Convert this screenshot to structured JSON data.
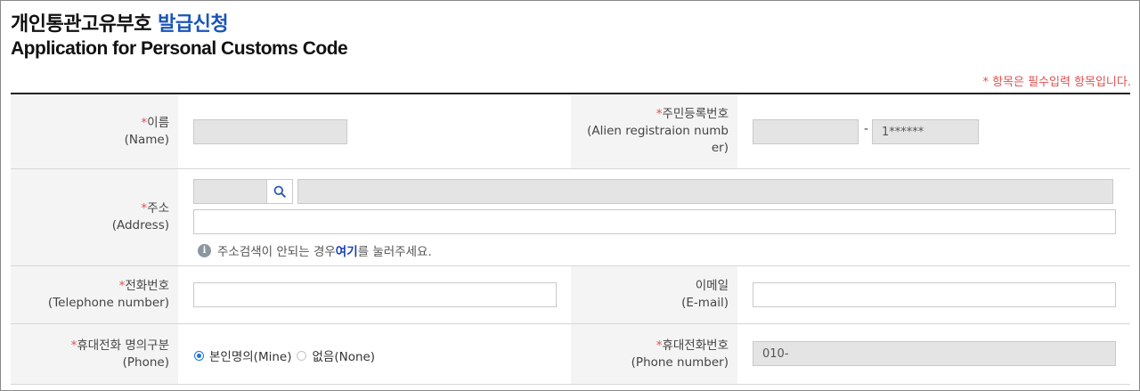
{
  "header": {
    "title_ko_main": "개인통관고유부호",
    "title_ko_accent": "발급신청",
    "title_en": "Application for Personal Customs Code",
    "required_note": "* 항목은 필수입력 항목입니다."
  },
  "rows": {
    "name": {
      "star": "*",
      "label_ko": "이름",
      "label_en": "(Name)",
      "value": ""
    },
    "rrn": {
      "star": "*",
      "label_ko": "주민등록번호",
      "label_en_1": "(Alien registraion numb",
      "label_en_2": "er)",
      "front_value": "",
      "dash": "-",
      "back_value": "1******"
    },
    "address": {
      "star": "*",
      "label_ko": "주소",
      "label_en": "(Address)",
      "zipcode": "",
      "base_address": "",
      "detail_address": "",
      "hint_before": "주소검색이 안되는 경우 ",
      "hint_link": "여기",
      "hint_after": "를 눌러주세요.",
      "search_icon": "search-icon",
      "info_icon": "info-icon"
    },
    "telephone": {
      "star": "*",
      "label_ko": "전화번호",
      "label_en": "(Telephone number)",
      "value": ""
    },
    "email": {
      "label_ko": "이메일",
      "label_en": "(E-mail)",
      "value": ""
    },
    "phone_owner": {
      "star": "*",
      "label_ko": "휴대전화 명의구분",
      "label_en": "(Phone)",
      "options": [
        {
          "label": "본인명의(Mine)",
          "checked": true
        },
        {
          "label": "없음(None)",
          "checked": false
        }
      ]
    },
    "mobile": {
      "star": "*",
      "label_ko": "휴대전화번호",
      "label_en": "(Phone number)",
      "value": "010-"
    }
  },
  "colors": {
    "accent_blue": "#1a56b8",
    "required_red": "#e0504f",
    "header_bg": "#f4f4f4",
    "readonly_bg": "#e4e4e4",
    "radio_blue": "#1a73e8"
  }
}
